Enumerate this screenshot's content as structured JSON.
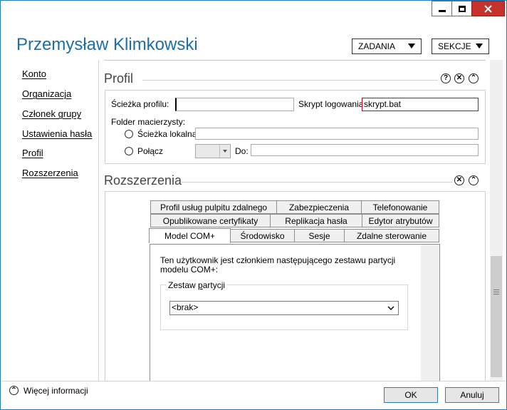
{
  "window": {
    "name": "Przemysław Klimkowski",
    "tasks_label": "ZADANIA",
    "sections_label": "SEKCJE"
  },
  "sidebar": {
    "items": [
      {
        "label": "Konto"
      },
      {
        "label": "Organizacja"
      },
      {
        "label": "Członek grupy"
      },
      {
        "label": "Ustawienia hasła"
      },
      {
        "label": "Profil"
      },
      {
        "label": "Rozszerzenia"
      }
    ]
  },
  "profile": {
    "title": "Profil",
    "profile_path_label": "Ścieżka profilu:",
    "profile_path_value": "",
    "logon_script_label": "Skrypt logowania:",
    "logon_script_value": "skrypt.bat",
    "home_folder_label": "Folder macierzysty:",
    "local_path_label": "Ścieżka lokalna",
    "local_path_value": "",
    "connect_label": "Połącz",
    "to_label": "Do:",
    "to_value": "",
    "help_icon": "question-icon",
    "close_icon": "close-icon",
    "collapse_icon": "chevron-up-icon"
  },
  "extensions": {
    "title": "Rozszerzenia",
    "tabs_row1": [
      "Profil usług pulpitu zdalnego",
      "Zabezpieczenia",
      "Telefonowanie"
    ],
    "tabs_row2": [
      "Opublikowane certyfikaty",
      "Replikacja hasła",
      "Edytor atrybutów"
    ],
    "tabs_row3": [
      "Model COM+",
      "Środowisko",
      "Sesje",
      "Zdalne sterowanie"
    ],
    "active_tab": "Model COM+",
    "description": "Ten użytkownik jest członkiem następującego zestawu partycji modelu COM+:",
    "group_label": "Zestaw partycji",
    "select_value": "<brak>"
  },
  "footer": {
    "more_info": "Więcej informacji",
    "ok": "OK",
    "cancel": "Anuluj"
  },
  "colors": {
    "accent": "#1e6ea7",
    "close_red": "#c7312c",
    "error_border": "#d0021b"
  }
}
